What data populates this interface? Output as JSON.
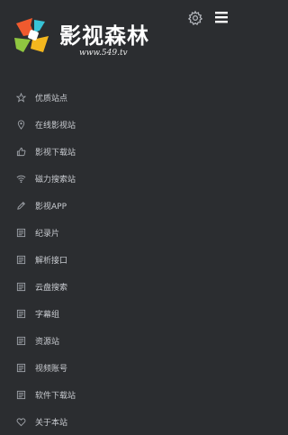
{
  "brand": {
    "title": "影视森林",
    "url": "www.549.tv",
    "logo_colors": [
      "#f05a2e",
      "#8fc640",
      "#37c3d6",
      "#f4b71e"
    ]
  },
  "header": {
    "settings_icon": "gear-icon",
    "menu_icon": "hamburger-icon"
  },
  "nav": {
    "items": [
      {
        "label": "优质站点",
        "icon": "star-icon"
      },
      {
        "label": "在线影视站",
        "icon": "location-pin-icon"
      },
      {
        "label": "影视下载站",
        "icon": "thumbs-up-icon"
      },
      {
        "label": "磁力搜索站",
        "icon": "wifi-icon"
      },
      {
        "label": "影视APP",
        "icon": "pencil-icon"
      },
      {
        "label": "纪录片",
        "icon": "document-icon"
      },
      {
        "label": "解析接口",
        "icon": "document-icon"
      },
      {
        "label": "云盘搜索",
        "icon": "document-icon"
      },
      {
        "label": "字幕组",
        "icon": "document-icon"
      },
      {
        "label": "资源站",
        "icon": "document-icon"
      },
      {
        "label": "视频账号",
        "icon": "document-icon"
      },
      {
        "label": "软件下载站",
        "icon": "document-icon"
      },
      {
        "label": "关于本站",
        "icon": "heart-icon"
      }
    ]
  }
}
